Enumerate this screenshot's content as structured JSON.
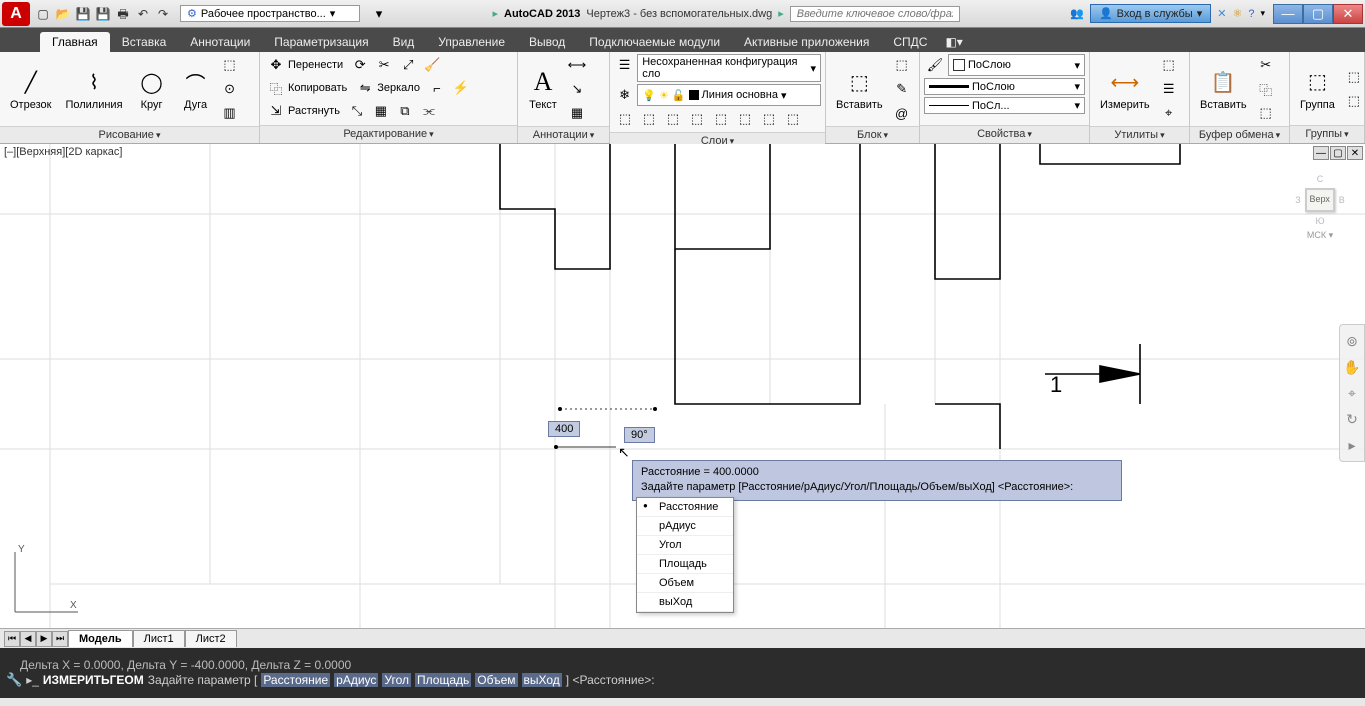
{
  "title": {
    "app": "AutoCAD 2013",
    "file": "Чертеж3 - без вспомогательных.dwg",
    "workspace": "Рабочее пространство...",
    "search_placeholder": "Введите ключевое слово/фразу",
    "login": "Вход в службы"
  },
  "tabs": [
    "Главная",
    "Вставка",
    "Аннотации",
    "Параметризация",
    "Вид",
    "Управление",
    "Вывод",
    "Подключаемые модули",
    "Активные приложения",
    "СПДС"
  ],
  "active_tab": 0,
  "ribbon": {
    "draw": {
      "title": "Рисование",
      "line": "Отрезок",
      "polyline": "Полилиния",
      "circle": "Круг",
      "arc": "Дуга"
    },
    "modify": {
      "title": "Редактирование",
      "move": "Перенести",
      "copy": "Копировать",
      "stretch": "Растянуть",
      "mirror": "Зеркало"
    },
    "annotation": {
      "title": "Аннотации",
      "text": "Текст"
    },
    "layers": {
      "title": "Слои",
      "dropdown": "Несохраненная конфигурация сло",
      "current": "Линия основна"
    },
    "block": {
      "title": "Блок",
      "insert": "Вставить"
    },
    "properties": {
      "title": "Свойства",
      "bycolor": "ПоСлою",
      "bylayer": "ПоСлою",
      "bylw": "ПоСл..."
    },
    "utilities": {
      "title": "Утилиты",
      "measure": "Измерить"
    },
    "clipboard": {
      "title": "Буфер обмена",
      "paste": "Вставить"
    },
    "groups": {
      "title": "Группы",
      "group": "Группа"
    }
  },
  "view": {
    "label": "[–][Верхняя][2D каркас]",
    "cube_face": "Верх",
    "mck": "МСК"
  },
  "dynamic": {
    "dist": "400",
    "angle": "90°",
    "tooltip_line1": "Расстояние = 400.0000",
    "tooltip_line2": "Задайте параметр [Расстояние/рАдиус/Угол/Площадь/Объем/выХод] <Расстояние>:",
    "options": [
      "Расстояние",
      "рАдиус",
      "Угол",
      "Площадь",
      "Объем",
      "выХод"
    ]
  },
  "layout_tabs": [
    "Модель",
    "Лист1",
    "Лист2"
  ],
  "active_layout": 0,
  "cmd": {
    "history": "Дельта X = 0.0000,  Дельта Y = -400.0000,   Дельта Z = 0.0000",
    "name": "ИЗМЕРИТЬГЕОМ",
    "prompt_pre": "Задайте параметр [",
    "opts": [
      "Расстояние",
      "рАдиус",
      "Угол",
      "Площадь",
      "Объем",
      "выХод"
    ],
    "prompt_post": "] <Расстояние>:"
  }
}
